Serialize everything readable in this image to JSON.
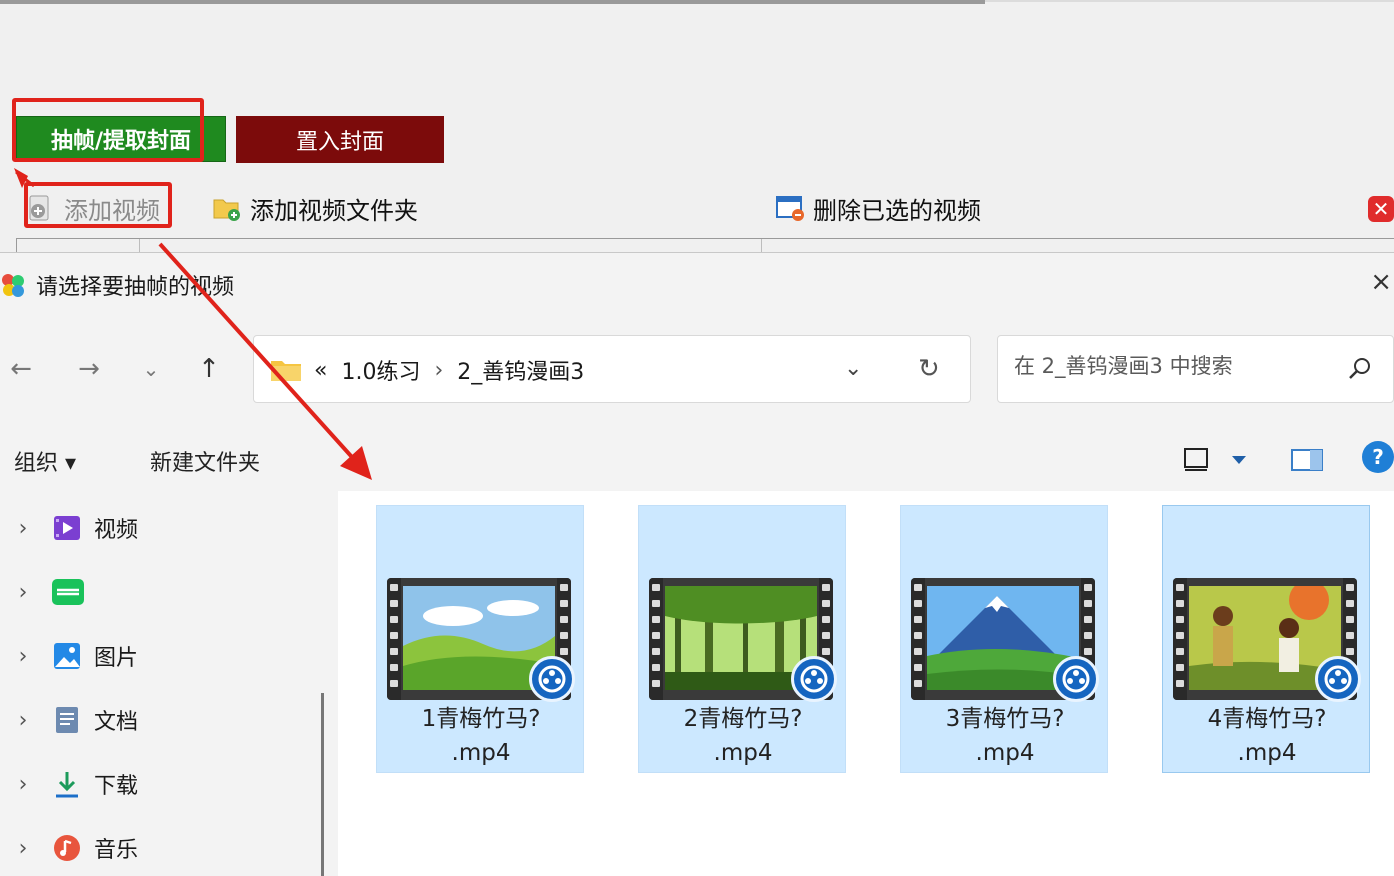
{
  "app": {
    "buttons": {
      "extract_cover": "抽帧/提取封面",
      "set_cover": "置入封面"
    },
    "toolbar": {
      "add_video": "添加视频",
      "add_folder": "添加视频文件夹",
      "delete_selected": "删除已选的视频",
      "close": "✕"
    }
  },
  "dialog": {
    "title": "请选择要抽帧的视频",
    "close": "×",
    "nav": {
      "back": "←",
      "forward": "→",
      "recent": "⌄",
      "up": "↑"
    },
    "address": {
      "overflow": "«",
      "crumbs": [
        "1.0练习",
        "2_善钨漫画3"
      ],
      "separator": "›",
      "dropdown": "⌄",
      "refresh": "↻"
    },
    "search": {
      "placeholder": "在 2_善钨漫画3 中搜索"
    },
    "commands": {
      "organize": "组织 ▾",
      "new_folder": "新建文件夹",
      "help": "?"
    },
    "sidebar": [
      {
        "label": "视频",
        "icon": "video-library-icon"
      },
      {
        "label": "",
        "icon": "iqiyi-icon"
      },
      {
        "label": "图片",
        "icon": "pictures-icon"
      },
      {
        "label": "文档",
        "icon": "documents-icon"
      },
      {
        "label": "下载",
        "icon": "downloads-icon"
      },
      {
        "label": "音乐",
        "icon": "music-icon"
      }
    ],
    "files": [
      {
        "line1": "1青梅竹马?",
        "line2": ".mp4",
        "scene": "meadow"
      },
      {
        "line1": "2青梅竹马?",
        "line2": ".mp4",
        "scene": "forest"
      },
      {
        "line1": "3青梅竹马?",
        "line2": ".mp4",
        "scene": "mountain"
      },
      {
        "line1": "4青梅竹马?",
        "line2": ".mp4",
        "scene": "children"
      }
    ]
  },
  "colors": {
    "extract_button": "#1f8a1f",
    "cover_button": "#7c0b0b",
    "highlight": "#e0231b",
    "selection": "#cce8ff"
  }
}
